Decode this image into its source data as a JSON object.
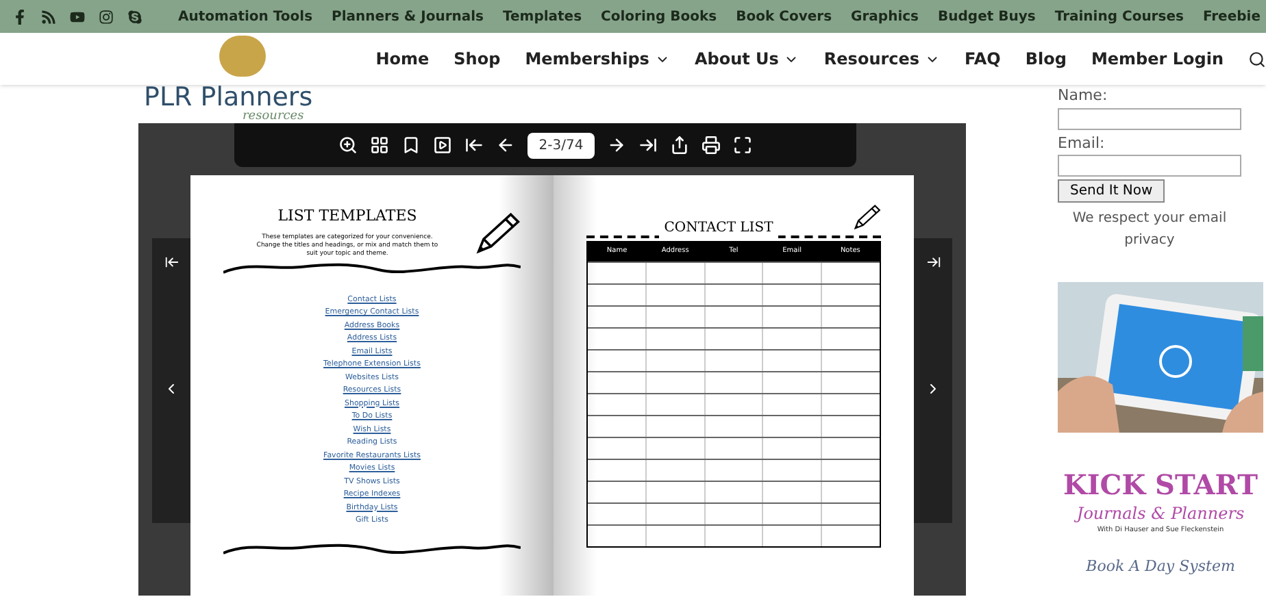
{
  "top_bar": {
    "links": [
      "Automation Tools",
      "Planners & Journals",
      "Templates",
      "Coloring Books",
      "Book Covers",
      "Graphics",
      "Budget Buys",
      "Training Courses",
      "Freebie"
    ]
  },
  "header": {
    "logo": {
      "title": "PLR Planners",
      "subtitle": "resources"
    },
    "nav": [
      {
        "label": "Home",
        "dropdown": false
      },
      {
        "label": "Shop",
        "dropdown": false
      },
      {
        "label": "Memberships",
        "dropdown": true
      },
      {
        "label": "About Us",
        "dropdown": true
      },
      {
        "label": "Resources",
        "dropdown": true
      },
      {
        "label": "FAQ",
        "dropdown": false
      },
      {
        "label": "Blog",
        "dropdown": false
      },
      {
        "label": "Member Login",
        "dropdown": false
      }
    ]
  },
  "viewer": {
    "page_indicator": "2-3/74",
    "left_page": {
      "title": "LIST TEMPLATES",
      "intro": "These templates are categorized for your convenience. Change the titles and headings, or mix and match them to suit your topic and theme.",
      "links": [
        {
          "label": "Contact Lists",
          "underlined": true
        },
        {
          "label": "Emergency Contact Lists",
          "underlined": true
        },
        {
          "label": "Address Books",
          "underlined": true
        },
        {
          "label": "Address Lists",
          "underlined": true
        },
        {
          "label": "Email Lists",
          "underlined": true
        },
        {
          "label": "Telephone Extension Lists",
          "underlined": true
        },
        {
          "label": "Websites Lists",
          "underlined": false
        },
        {
          "label": "Resources Lists",
          "underlined": true
        },
        {
          "label": "Shopping Lists",
          "underlined": true
        },
        {
          "label": "To Do Lists",
          "underlined": true
        },
        {
          "label": "Wish Lists",
          "underlined": true
        },
        {
          "label": "Reading Lists",
          "underlined": false
        },
        {
          "label": "Favorite Restaurants Lists",
          "underlined": true
        },
        {
          "label": "Movies Lists",
          "underlined": true
        },
        {
          "label": "TV Shows Lists",
          "underlined": false
        },
        {
          "label": "Recipe Indexes",
          "underlined": true
        },
        {
          "label": "Birthday Lists",
          "underlined": true
        },
        {
          "label": "Gift Lists",
          "underlined": false
        }
      ]
    },
    "right_page": {
      "title": "CONTACT LIST",
      "columns": [
        "Name",
        "Address",
        "Tel",
        "Email",
        "Notes"
      ]
    }
  },
  "sidebar": {
    "name_label": "Name:",
    "email_label": "Email:",
    "submit": "Send It Now",
    "privacy": "We respect your email privacy",
    "kickstart": {
      "title": "KICK START",
      "subtitle": "Journals & Planners",
      "byline": "With Di Hauser and Sue Fleckenstein"
    },
    "book_a_day": "Book A Day System"
  }
}
